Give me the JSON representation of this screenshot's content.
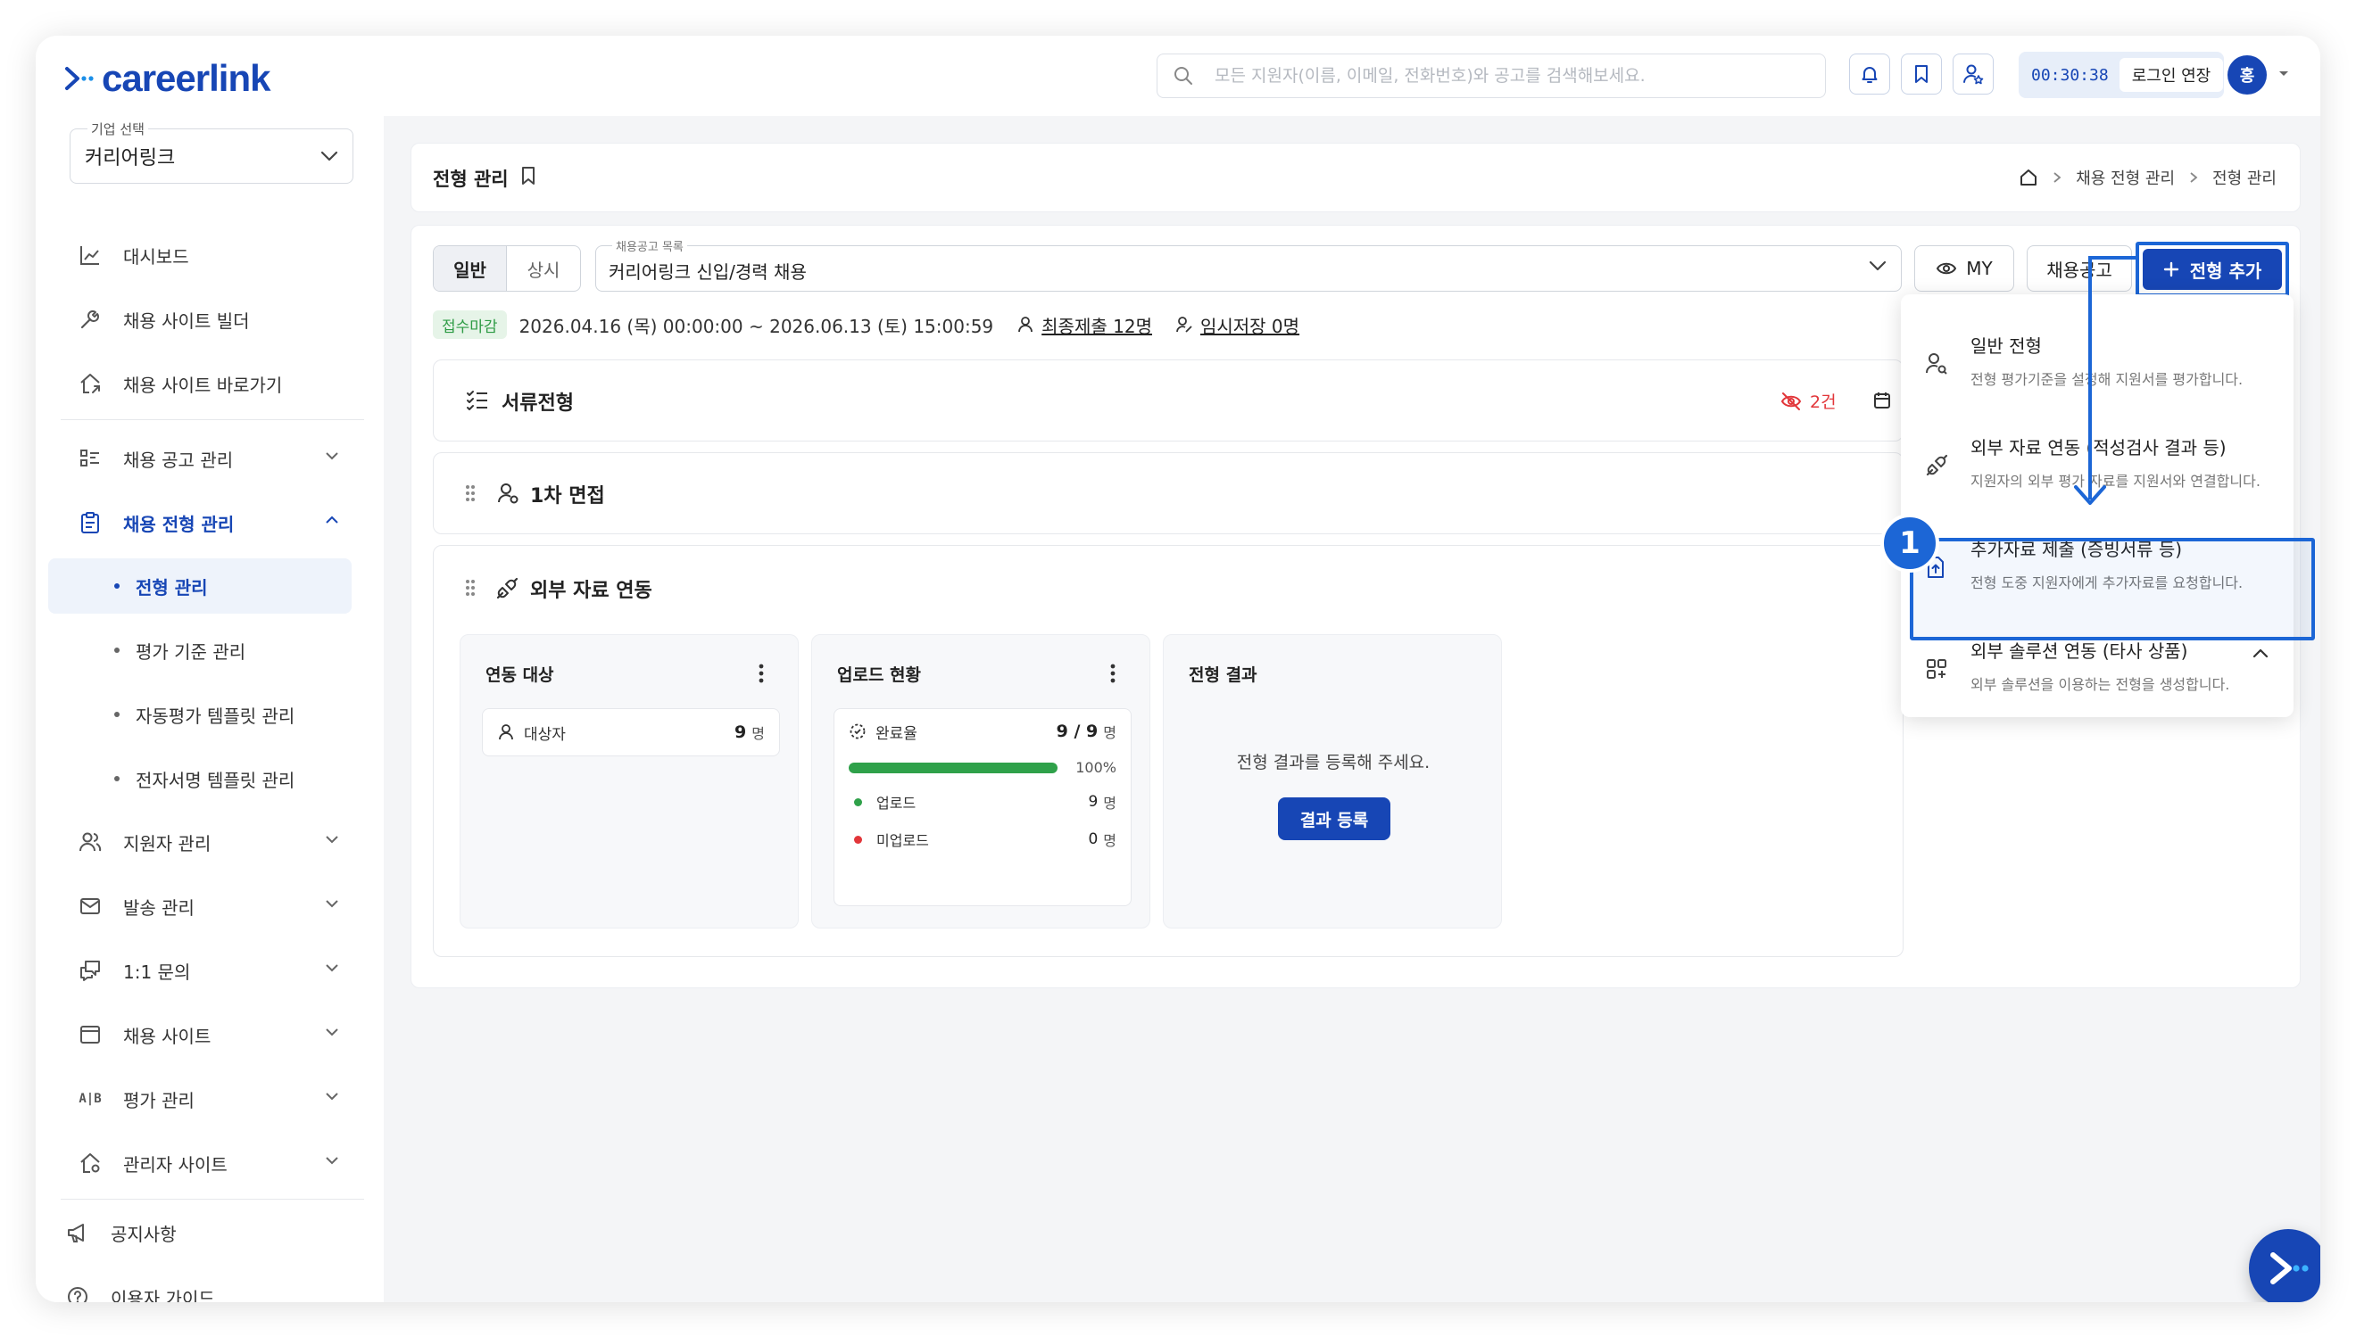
{
  "header": {
    "logo_text": "careerlink",
    "search_placeholder": "모든 지원자(이름, 이메일, 전화번호)와 공고를 검색해보세요.",
    "timer": "00:30:38",
    "extend_login": "로그인 연장",
    "avatar_initial": "홍"
  },
  "sidebar": {
    "company_label": "기업 선택",
    "company_value": "커리어링크",
    "items": [
      {
        "label": "대시보드",
        "icon": "chart-icon"
      },
      {
        "label": "채용 사이트 빌더",
        "icon": "tools-icon"
      },
      {
        "label": "채용 사이트 바로가기",
        "icon": "home-link-icon"
      },
      {
        "label": "채용 공고 관리",
        "icon": "list-icon"
      },
      {
        "label": "채용 전형 관리",
        "icon": "clipboard-icon"
      },
      {
        "label": "지원자 관리",
        "icon": "users-icon"
      },
      {
        "label": "발송 관리",
        "icon": "mail-icon"
      },
      {
        "label": "1:1 문의",
        "icon": "chat-icon"
      },
      {
        "label": "채용 사이트",
        "icon": "window-icon"
      },
      {
        "label": "평가 관리",
        "icon": "ab-icon",
        "icon_text": "A|B"
      },
      {
        "label": "관리자 사이트",
        "icon": "admin-home-icon"
      }
    ],
    "sub_items": [
      "전형 관리",
      "평가 기준 관리",
      "자동평가 템플릿 관리",
      "전자서명 템플릿 관리"
    ],
    "footer": [
      {
        "label": "공지사항",
        "icon": "megaphone-icon"
      },
      {
        "label": "이용자 가이드",
        "icon": "help-icon"
      }
    ]
  },
  "page": {
    "title": "전형 관리",
    "breadcrumb": [
      "채용 전형 관리",
      "전형 관리"
    ]
  },
  "toolbar": {
    "tabs": [
      "일반",
      "상시"
    ],
    "job_select_caption": "채용공고 목록",
    "job_select_value": "커리어링크 신입/경력 채용",
    "my_label": "MY",
    "posting_label": "채용공고",
    "add_label": "전형 추가"
  },
  "info": {
    "status_badge": "접수마감",
    "date_range": "2026.04.16 (목) 00:00:00 ~ 2026.06.13 (토) 15:00:59",
    "final_submit": "최종제출 12명",
    "temp_save": "임시저장 0명"
  },
  "stages": {
    "doc": {
      "title": "서류전형",
      "hidden_count": "2건"
    },
    "interview": {
      "title": "1차 면접"
    },
    "external": {
      "title": "외부 자료 연동"
    }
  },
  "cards": {
    "target": {
      "title": "연동 대상",
      "row_label": "대상자",
      "value": "9",
      "unit": "명"
    },
    "upload": {
      "title": "업로드 현황",
      "rate_label": "완료율",
      "rate_value": "9 / 9",
      "unit": "명",
      "progress": 100,
      "pct_text": "100%",
      "uploaded_label": "업로드",
      "uploaded_value": "9",
      "not_uploaded_label": "미업로드",
      "not_uploaded_value": "0"
    },
    "result": {
      "title": "전형 결과",
      "message": "전형 결과를 등록해 주세요.",
      "button": "결과 등록"
    }
  },
  "dropdown": {
    "items": [
      {
        "title": "일반 전형",
        "desc": "전형 평가기준을 설정해 지원서를 평가합니다."
      },
      {
        "title": "외부 자료 연동 (적성검사 결과 등)",
        "desc": "지원자의 외부 평가 자료를 지원서와 연결합니다."
      },
      {
        "title": "추가자료 제출 (증빙서류 등)",
        "desc": "전형 도중 지원자에게 추가자료를 요청합니다."
      },
      {
        "title": "외부 솔루션 연동 (타사 상품)",
        "desc": "외부 솔루션을 이용하는 전형을 생성합니다."
      }
    ]
  },
  "annotation": {
    "step_number": "1"
  },
  "colors": {
    "primary": "#1746b5",
    "highlight": "#1c66d6",
    "success": "#2fa14a",
    "danger": "#e2363a"
  }
}
